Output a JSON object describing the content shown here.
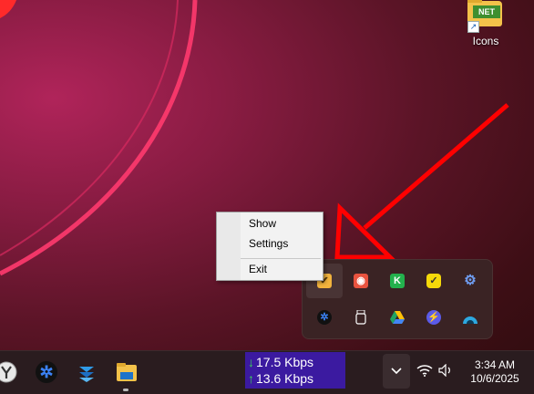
{
  "desktop": {
    "icons": [
      {
        "label": "Icons",
        "badge": "NET",
        "icon": "folder-icon"
      }
    ]
  },
  "context_menu": {
    "items": [
      {
        "label": "Show"
      },
      {
        "label": "Settings"
      },
      {
        "label": "Exit"
      }
    ]
  },
  "tray_overflow": {
    "icons": [
      {
        "icon": "checkbox-app-icon",
        "color": "#f2b33d"
      },
      {
        "icon": "record-app-icon",
        "color": "#e8533f"
      },
      {
        "icon": "k-app-icon",
        "glyph": "K",
        "color": "#23b14d"
      },
      {
        "icon": "check-circle-app-icon",
        "color": "#f5d90a"
      },
      {
        "icon": "gear-app-icon",
        "color": "#4a7bd8"
      },
      {
        "icon": "shutter-app-icon",
        "color": "#2b6fe0"
      },
      {
        "icon": "usb-drive-icon",
        "color": "#ffffff"
      },
      {
        "icon": "google-drive-icon",
        "color": "#1fa463"
      },
      {
        "icon": "speed-app-icon",
        "color": "#5b5be8"
      },
      {
        "icon": "gauge-app-icon",
        "color": "#2da8e0"
      }
    ]
  },
  "taskbar": {
    "apps": [
      {
        "icon": "yandex-browser-icon"
      },
      {
        "icon": "shutter-app-icon"
      },
      {
        "icon": "stack-app-icon"
      },
      {
        "icon": "file-explorer-icon"
      }
    ],
    "network": {
      "download": "17.5 Kbps",
      "upload": "13.6 Kbps",
      "bg_color": "#3b1aa0"
    },
    "clock": {
      "time": "3:34 AM",
      "date": "10/6/2025"
    }
  },
  "colors": {
    "arrow": "#ff0000"
  }
}
